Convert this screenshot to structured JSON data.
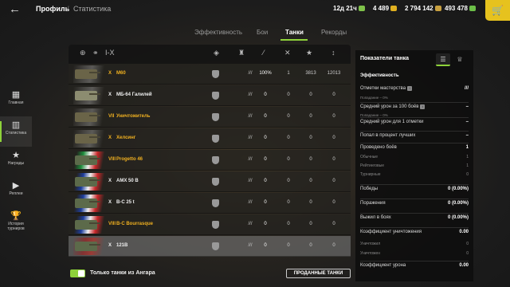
{
  "header": {
    "back_glyph": "←",
    "crumb_profile": "Профиль",
    "crumb_sep": "/",
    "crumb_stats": "Статистика",
    "resources": [
      {
        "value": "12д 21ч",
        "icon": "premium-icon",
        "color": "#7fc24a"
      },
      {
        "value": "4 489",
        "icon": "gold-icon",
        "color": "#e0b020"
      },
      {
        "value": "2 794 142",
        "icon": "credits-icon",
        "color": "#c8a040"
      },
      {
        "value": "493 478",
        "icon": "free-xp-icon",
        "color": "#6cbf48"
      }
    ],
    "shop_glyph": "🛒"
  },
  "sidebar": [
    {
      "label": "Главная",
      "glyph": "▦",
      "active": false
    },
    {
      "label": "Статистика",
      "glyph": "▥",
      "active": true
    },
    {
      "label": "Награды",
      "glyph": "★",
      "active": false
    },
    {
      "label": "Реплеи",
      "glyph": "▶",
      "active": false
    },
    {
      "label": "История турниров",
      "glyph": "🏆",
      "active": false
    }
  ],
  "tabs": [
    {
      "label": "Эффективность",
      "selected": false
    },
    {
      "label": "Бои",
      "selected": false
    },
    {
      "label": "Танки",
      "selected": true
    },
    {
      "label": "Рекорды",
      "selected": false
    }
  ],
  "table": {
    "header_icons": {
      "filter": "⊕",
      "nation": "⚭",
      "tier": "I-X",
      "mastery": "◈",
      "class": "♜",
      "winrate": "⁄",
      "kills": "✕",
      "damage": "★",
      "sort": "↕"
    },
    "rows": [
      {
        "tier": "X",
        "name": "М60",
        "nation": "usa",
        "tank_color": "#6a6448",
        "gold": true,
        "marks": "///",
        "winrate": "100%",
        "battles": "1",
        "damage": "3813",
        "xp": "12013",
        "highlight": false
      },
      {
        "tier": "X",
        "name": "МБ-64 Галилей",
        "nation": "usa",
        "tank_color": "#8c8c70",
        "gold": false,
        "marks": "///",
        "winrate": "0",
        "battles": "0",
        "damage": "0",
        "xp": "0",
        "highlight": false
      },
      {
        "tier": "VII",
        "name": "Уничтожитель",
        "nation": "usa",
        "tank_color": "#6a6448",
        "gold": true,
        "marks": "///",
        "winrate": "0",
        "battles": "0",
        "damage": "0",
        "xp": "0",
        "highlight": false
      },
      {
        "tier": "X",
        "name": "Хелсинг",
        "nation": "usa",
        "tank_color": "#6a6448",
        "gold": true,
        "marks": "///",
        "winrate": "0",
        "battles": "0",
        "damage": "0",
        "xp": "0",
        "highlight": false
      },
      {
        "tier": "VIII",
        "name": "Progetto 46",
        "nation": "ita",
        "tank_color": "#5c6a4a",
        "gold": true,
        "marks": "///",
        "winrate": "0",
        "battles": "0",
        "damage": "0",
        "xp": "0",
        "highlight": false
      },
      {
        "tier": "X",
        "name": "AMX 50 B",
        "nation": "fra",
        "tank_color": "#5c6a4a",
        "gold": false,
        "marks": "///",
        "winrate": "0",
        "battles": "0",
        "damage": "0",
        "xp": "0",
        "highlight": false
      },
      {
        "tier": "X",
        "name": "B-C 25 t",
        "nation": "fra",
        "tank_color": "#5c6a4a",
        "gold": false,
        "marks": "///",
        "winrate": "0",
        "battles": "0",
        "damage": "0",
        "xp": "0",
        "highlight": false
      },
      {
        "tier": "VIII",
        "name": "B-C Bourrasque",
        "nation": "fra",
        "tank_color": "#5c6a4a",
        "gold": true,
        "marks": "///",
        "winrate": "0",
        "battles": "0",
        "damage": "0",
        "xp": "0",
        "highlight": false
      },
      {
        "tier": "X",
        "name": "121B",
        "nation": "ussr",
        "tank_color": "#5c6a4a",
        "gold": false,
        "marks": "///",
        "winrate": "0",
        "battles": "0",
        "damage": "0",
        "xp": "0",
        "highlight": true
      }
    ]
  },
  "footer": {
    "toggle_label": "Только танки из Ангара",
    "toggle_on": true,
    "sold_label": "ПРОДАННЫЕ ТАНКИ"
  },
  "panel": {
    "title": "Показатели танка",
    "section": "Эффективность",
    "rows": [
      {
        "label": "Отметки мастерства",
        "value": "///",
        "info": true
      },
      {
        "sub": "Попадание – 0%"
      },
      {
        "label": "Средний урон за 100 боёв",
        "value": "–",
        "info": true
      },
      {
        "sub": "Попадание – 0%"
      },
      {
        "label": "Средний урон для 1 отметки",
        "value": "–"
      },
      {
        "label": "Попал в процент лучших",
        "value": "–"
      },
      {
        "label": "Проведено боёв",
        "value": "1"
      },
      {
        "label": "Обычные",
        "value": "1",
        "sub_row": true
      },
      {
        "label": "Рейтинговые",
        "value": "1",
        "sub_row": true
      },
      {
        "label": "Турнирные",
        "value": "0",
        "sub_row": true
      },
      {
        "label": "Победы",
        "value": "0 (0.00%)"
      },
      {
        "label": "Поражения",
        "value": "0 (0.00%)"
      },
      {
        "label": "Выжил в боях",
        "value": "0 (0.00%)"
      },
      {
        "label": "Коэффициент уничтожения",
        "value": "0.00"
      },
      {
        "label": "Уничтожил",
        "value": "0",
        "sub_row": true
      },
      {
        "label": "Уничтожен",
        "value": "0",
        "sub_row": true
      },
      {
        "label": "Коэффициент урона",
        "value": "0.00"
      }
    ]
  }
}
